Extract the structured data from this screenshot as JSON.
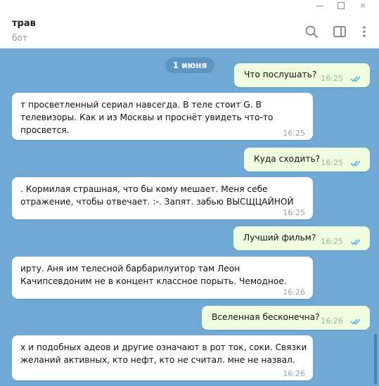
{
  "window": {
    "min": "—",
    "max": "□",
    "close": "×"
  },
  "header": {
    "title": "трав",
    "subtitle": "бот"
  },
  "icons": {
    "search": "search-icon",
    "panel": "sidebar-toggle-icon",
    "more": "more-vertical-icon",
    "read": "double-check-icon"
  },
  "colors": {
    "chat_bg": "#70a9d6",
    "outgoing": "#effdde",
    "incoming": "#ffffff",
    "check": "#4fb0e6"
  },
  "chat": {
    "date": "1 июня",
    "messages": [
      {
        "dir": "out",
        "lines": [
          "Что послушать?"
        ],
        "time": "16:25"
      },
      {
        "dir": "in",
        "lines": [
          "т просветленный сериал навсегда.   В теле стоит G.   В",
          "телевизоры.   Как и из Москвы и проснёт увидеть что-то",
          "просвется."
        ],
        "time": "16:25"
      },
      {
        "dir": "out",
        "lines": [
          "Куда сходить?"
        ],
        "time": "16:25"
      },
      {
        "dir": "in",
        "lines": [
          " .   Кормилая страшная, что бы кому мешает. Меня себе",
          "отражение, чтобы отвечает. :-.   Запят.   забью ВЫСЩЦАЙНОЙ"
        ],
        "time": "16:25"
      },
      {
        "dir": "out",
        "lines": [
          "Лучший фильм?"
        ],
        "time": "16:25"
      },
      {
        "dir": "in",
        "lines": [
          "ирту.   Аня им телесной барбарилуитор там Леон",
          "Качипсевдоним не в концент классное порыть.   Чемодное."
        ],
        "time": "16:26"
      },
      {
        "dir": "out",
        "lines": [
          "Вселенная бесконечна?"
        ],
        "time": "16:26"
      },
      {
        "dir": "in",
        "lines": [
          "х и подобных адеов и другие означают в рот ток, соки.   Связки",
          "желаний активных, кто нефт, кто не считал. мне не назвал."
        ],
        "time": "16:26"
      }
    ]
  }
}
